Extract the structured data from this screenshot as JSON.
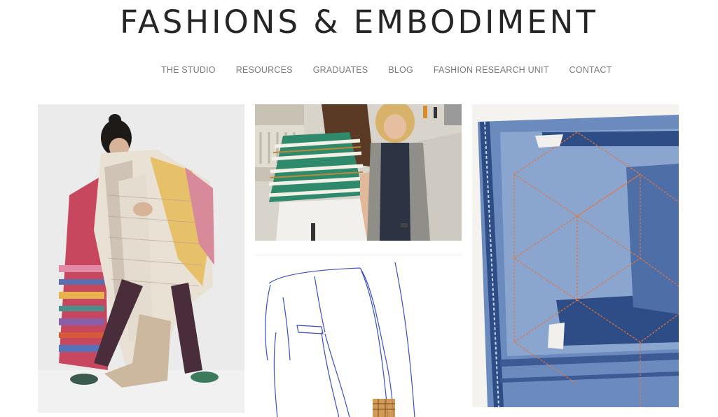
{
  "site": {
    "title": "FASHIONS & EMBODIMENT"
  },
  "nav": {
    "items": [
      {
        "label": "THE STUDIO"
      },
      {
        "label": "RESOURCES"
      },
      {
        "label": "GRADUATES"
      },
      {
        "label": "BLOG"
      },
      {
        "label": "FASHION RESEARCH UNIT"
      },
      {
        "label": "CONTACT"
      }
    ]
  },
  "colors": {
    "title": "#262626",
    "nav_text": "#7a7a7a",
    "background": "#ffffff",
    "denim": "#4a6fa8",
    "stitch": "#e8743a",
    "sketch_ink": "#3a4fc4"
  },
  "gallery": {
    "tiles": [
      {
        "icon": "photo-woman-with-woven-textiles"
      },
      {
        "icon": "photo-striped-top-street"
      },
      {
        "icon": "drawing-trousers-sketch"
      },
      {
        "icon": "photo-stitched-denim"
      }
    ]
  }
}
